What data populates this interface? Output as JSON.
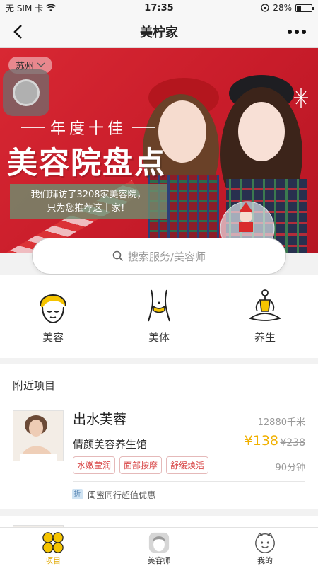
{
  "status_bar": {
    "carrier": "无 SIM 卡",
    "time": "17:35",
    "battery": "28%",
    "battery_level": 0.28
  },
  "nav": {
    "title": "美柠家",
    "back_icon": "chevron-left-icon",
    "more_icon": "more-dots-icon"
  },
  "banner": {
    "city": "苏州",
    "subtitle": "年度十佳",
    "title": "美容院盘点",
    "desc_line1": "我们拜访了3208家美容院，",
    "desc_line2": "只为您推荐这十家！",
    "background_color": "#d82833"
  },
  "search": {
    "placeholder": "搜索服务/美容师"
  },
  "categories": [
    {
      "label": "美容",
      "icon": "face-beauty-icon"
    },
    {
      "label": "美体",
      "icon": "body-waist-icon"
    },
    {
      "label": "养生",
      "icon": "meditation-icon"
    }
  ],
  "nearby": {
    "section_title": "附近项目",
    "item": {
      "name": "出水芙蓉",
      "distance": "12880千米",
      "shop": "倩颜美容养生馆",
      "price": "¥138",
      "original_price": "¥238",
      "tags": [
        "水嫩莹润",
        "面部按摩",
        "舒缓焕活"
      ],
      "duration": "90分钟",
      "promo_icon": "折",
      "promo_text": "闺蜜同行超值优惠"
    }
  },
  "tab_bar": {
    "tabs": [
      {
        "label": "项目",
        "icon": "project-grid-icon",
        "active": true
      },
      {
        "label": "美容师",
        "icon": "beautician-icon",
        "active": false
      },
      {
        "label": "我的",
        "icon": "profile-face-icon",
        "active": false
      }
    ]
  },
  "colors": {
    "accent": "#f5c400",
    "price": "#f0b000",
    "tag_text": "#d94a4a"
  }
}
